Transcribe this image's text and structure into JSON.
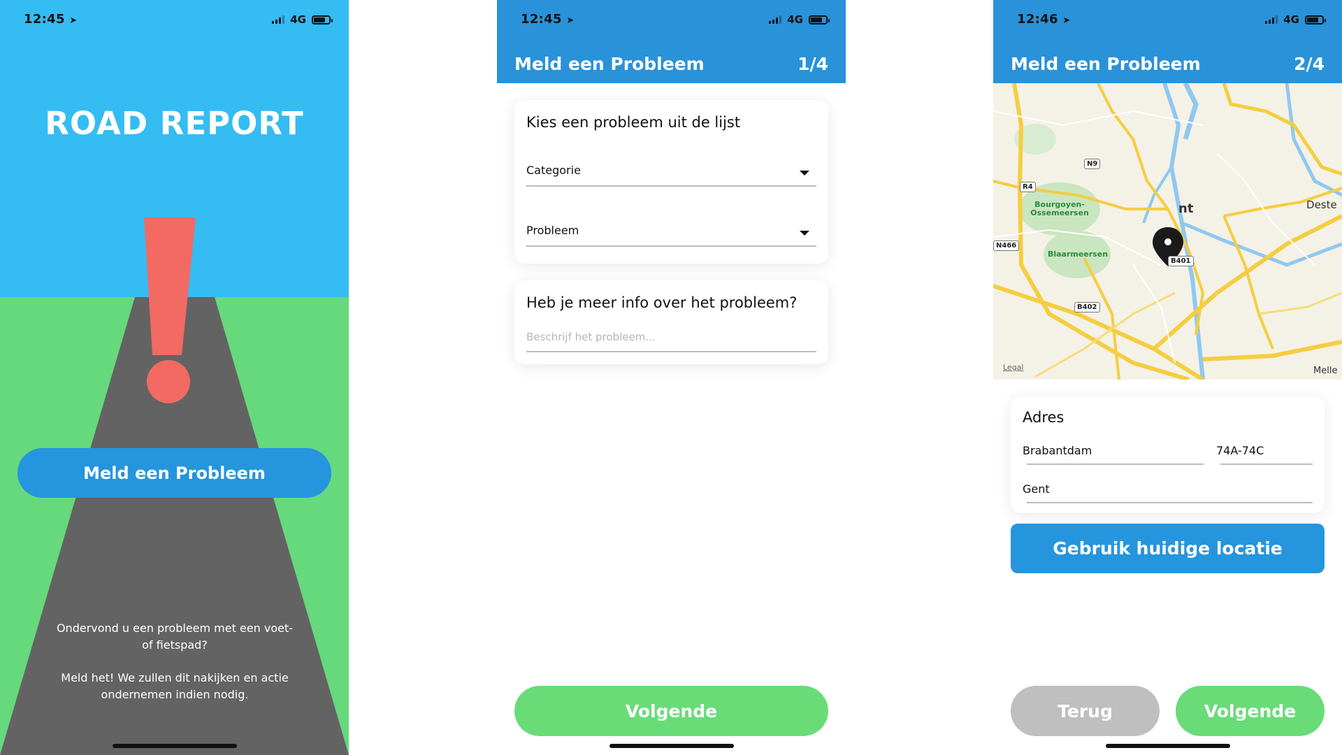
{
  "colors": {
    "sky": "#34bcf3",
    "grass": "#65d97c",
    "road": "#636363",
    "exclamation": "#f26a62",
    "primary_blue": "#2595dd",
    "appbar_blue": "#2a92d9",
    "green_button": "#69dc78",
    "grey_button": "#bfbfbf"
  },
  "screen1": {
    "status_time": "12:45",
    "network": "4G",
    "title": "ROAD REPORT",
    "cta_label": "Meld een Probleem",
    "message_line1": "Ondervond u een probleem met een voet- of fietspad?",
    "message_line2": "Meld het! We zullen dit nakijken en actie ondernemen indien nodig."
  },
  "screen2": {
    "status_time": "12:45",
    "network": "4G",
    "header_title": "Meld een Probleem",
    "step": "1/4",
    "card1": {
      "title": "Kies een probleem uit de lijst",
      "category_label": "Categorie",
      "problem_label": "Probleem"
    },
    "card2": {
      "title": "Heb je meer info over het probleem?",
      "description_placeholder": "Beschrijf het probleem..."
    },
    "next_label": "Volgende"
  },
  "screen3": {
    "status_time": "12:46",
    "network": "4G",
    "header_title": "Meld een Probleem",
    "step": "2/4",
    "map": {
      "labels": {
        "bourgoyen": "Bourgoyen-\nOssemeersen",
        "blaarmeersen": "Blaarmeersen",
        "gent_suffix": "nt",
        "deste": "Deste",
        "melle": "Melle",
        "legal": "Legal"
      },
      "shields": [
        "N9",
        "R4",
        "N466",
        "B401",
        "B402"
      ]
    },
    "address": {
      "title": "Adres",
      "street": "Brabantdam",
      "number": "74A-74C",
      "city": "Gent"
    },
    "use_location_label": "Gebruik huidige locatie",
    "back_label": "Terug",
    "next_label": "Volgende"
  }
}
